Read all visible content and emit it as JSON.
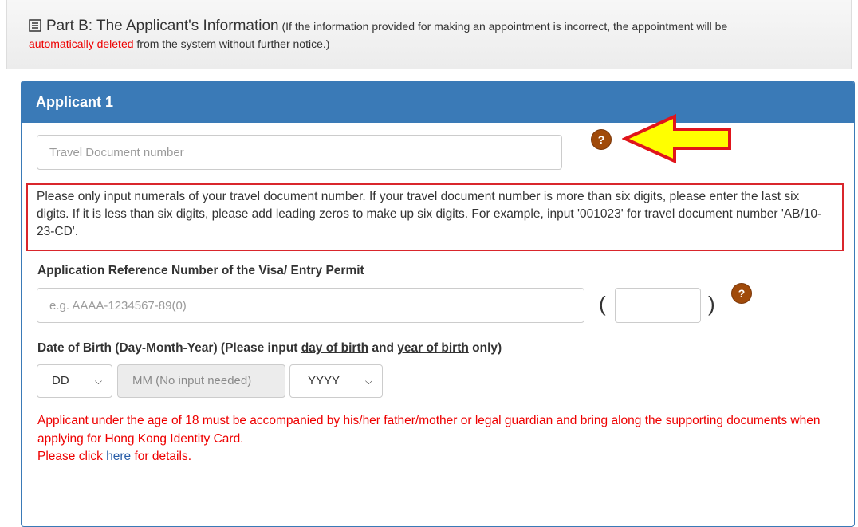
{
  "part_b": {
    "title": "Part B: The Applicant's Information",
    "note_prefix": "(If the information provided for making an appointment is incorrect, the appointment will be",
    "note_red": "automatically deleted",
    "note_suffix": "from the system without further notice.)"
  },
  "applicant": {
    "heading": "Applicant 1",
    "travel_doc_placeholder": "Travel Document number",
    "help_glyph": "?",
    "travel_doc_notice": "Please only input numerals of your travel document number. If your travel document number is more than six digits, please enter the last six digits. If it is less than six digits, please add leading zeros to make up six digits. For example, input '001023' for travel document number 'AB/10-23-CD'.",
    "ref_label": "Application Reference Number of the Visa/ Entry Permit",
    "ref_placeholder": "e.g. AAAA-1234567-89(0)",
    "paren_open": "(",
    "paren_close": ")",
    "dob_label_prefix": "Date of Birth (Day-Month-Year) (Please input ",
    "dob_label_day": "day of birth",
    "dob_label_and": " and ",
    "dob_label_year": "year of birth",
    "dob_label_suffix": " only)",
    "dob_day": "DD",
    "dob_month": "MM (No input needed)",
    "dob_year": "YYYY",
    "age_warning": "Applicant under the age of 18 must be accompanied by his/her father/mother or legal guardian and bring along the supporting documents when applying for Hong Kong Identity Card.",
    "click_prefix": "Please click ",
    "click_link": "here",
    "click_suffix": " for details."
  },
  "colors": {
    "panel_header": "#3a7ab7",
    "help_icon": "#a04a0a",
    "arrow_fill": "#ffff00",
    "arrow_stroke": "#e0151b",
    "notice_border": "#d9262c",
    "warning_text": "#ee0000",
    "link": "#2a5ea8"
  },
  "icons": {
    "part_icon": "list-form-icon",
    "annotation": "yellow-arrow-pointer-icon"
  }
}
